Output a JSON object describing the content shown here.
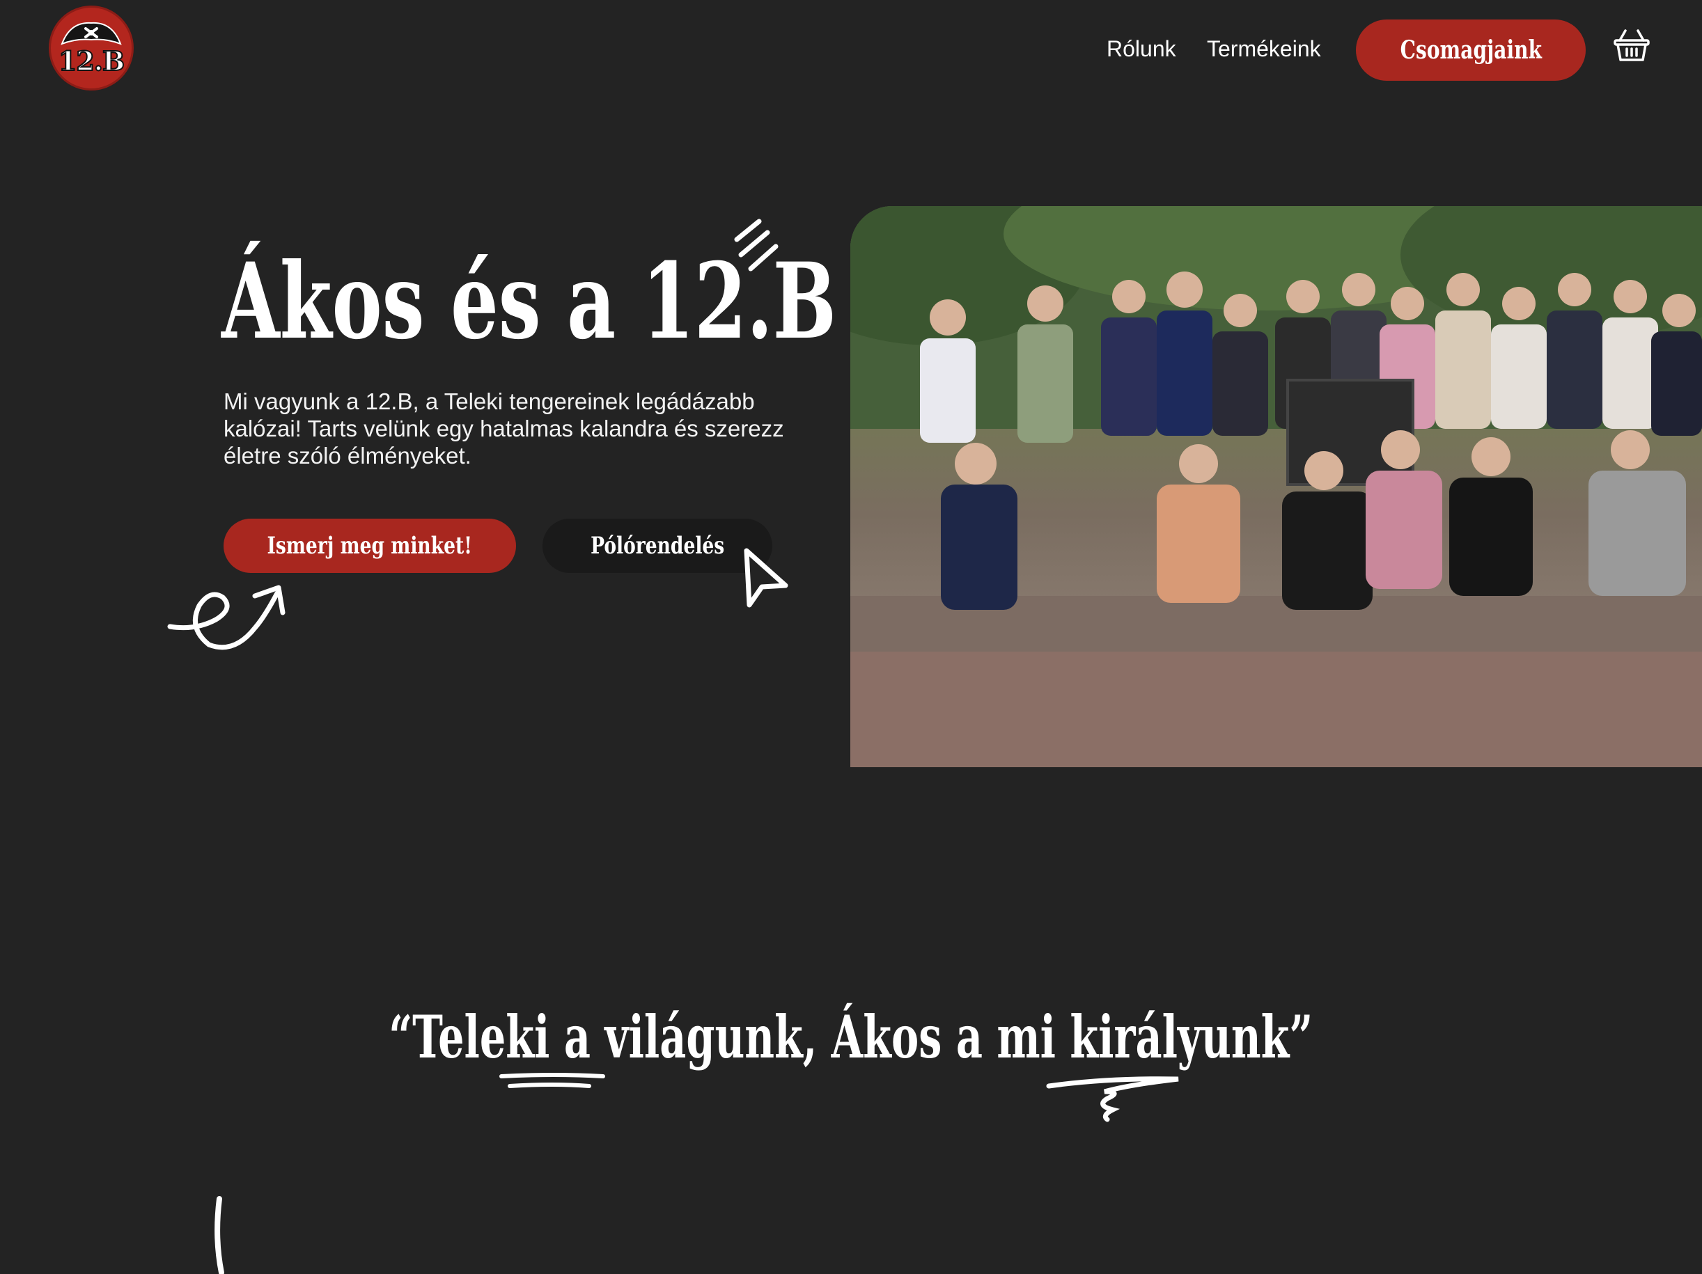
{
  "nav": {
    "logo_text": "12.B",
    "links": [
      "Rólunk",
      "Termékeink"
    ],
    "cta_label": "Csomagjaink"
  },
  "hero": {
    "title": "Ákos és a 12.B",
    "subtitle": "Mi vagyunk a 12.B, a Teleki tengereinek legádázabb kalózai! Tarts velünk egy hatalmas kalandra és szerezz életre szóló élményeket.",
    "primary_button": "Ismerj meg minket!",
    "secondary_button": "Pólórendelés"
  },
  "quote": {
    "text": "“Teleki a világunk, Ákos a mi királyunk”"
  },
  "colors": {
    "background": "#232323",
    "accent": "#a8271f",
    "text": "#ffffff"
  },
  "icons": [
    "pirate-hat-icon",
    "basket-icon",
    "cursor-icon",
    "arrow-doodle-icon",
    "sparkle-lines-icon"
  ]
}
